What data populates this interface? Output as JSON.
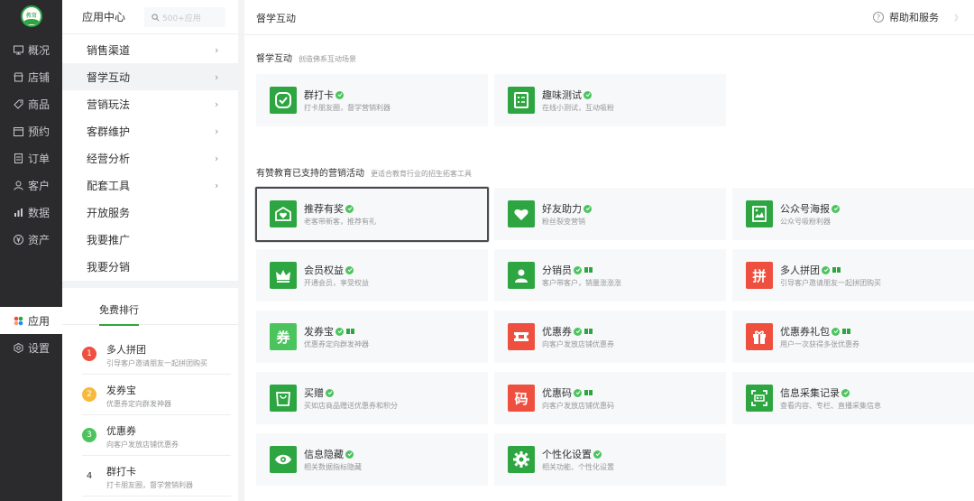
{
  "rail": {
    "items": [
      {
        "label": "概况",
        "icon": "monitor-icon"
      },
      {
        "label": "店铺",
        "icon": "store-icon"
      },
      {
        "label": "商品",
        "icon": "tag-icon"
      },
      {
        "label": "预约",
        "icon": "calendar-icon"
      },
      {
        "label": "订单",
        "icon": "order-icon"
      },
      {
        "label": "客户",
        "icon": "user-icon"
      },
      {
        "label": "数据",
        "icon": "bar-chart-icon"
      },
      {
        "label": "资产",
        "icon": "yen-icon"
      }
    ],
    "app": {
      "label": "应用",
      "icon": "apps-icon"
    },
    "settings": {
      "label": "设置",
      "icon": "gear-icon"
    }
  },
  "subnav": {
    "title": "应用中心",
    "search_placeholder": "500+应用",
    "items": [
      {
        "label": "销售渠道",
        "has_arrow": true
      },
      {
        "label": "督学互动",
        "has_arrow": true
      },
      {
        "label": "营销玩法",
        "has_arrow": true
      },
      {
        "label": "客群维护",
        "has_arrow": true
      },
      {
        "label": "经营分析",
        "has_arrow": true
      },
      {
        "label": "配套工具",
        "has_arrow": true
      },
      {
        "label": "开放服务",
        "has_arrow": false
      },
      {
        "label": "我要推广",
        "has_arrow": false
      },
      {
        "label": "我要分销",
        "has_arrow": false
      }
    ],
    "rank_tab": "免费排行",
    "rank": [
      {
        "num": "1",
        "name": "多人拼团",
        "desc": "引导客户邀请朋友一起拼团购买",
        "color": "#ee0a24"
      },
      {
        "num": "2",
        "name": "发券宝",
        "desc": "优惠券定向群发神器",
        "color": "#ff976a"
      },
      {
        "num": "3",
        "name": "优惠券",
        "desc": "向客户发放店铺优惠券",
        "color": "#2da641"
      },
      {
        "num": "4",
        "name": "群打卡",
        "desc": "打卡朋友圈，督学营销利器",
        "color": ""
      }
    ]
  },
  "main": {
    "page_title": "督学互动",
    "help_label": "帮助和服务",
    "collapse_label": "》",
    "section1": {
      "title": "督学互动",
      "subtitle": "创造佛系互动场景"
    },
    "section2": {
      "title": "有赞教育已支持的营销活动",
      "subtitle": "更适合教育行业的招生拓客工具"
    },
    "cards1": [
      {
        "name": "群打卡",
        "desc": "打卡朋友圈，督学营销利器",
        "color": "#2da641",
        "icon": "check-badge-icon"
      },
      {
        "name": "趣味测试",
        "desc": "在线小测试，互动吸粉",
        "color": "#2da641",
        "icon": "quiz-list-icon"
      }
    ],
    "cards2": [
      {
        "name": "推荐有奖",
        "desc": "老客带新客，推荐有礼",
        "color": "#2da641",
        "icon": "gift-heart-icon",
        "badge": false
      },
      {
        "name": "好友助力",
        "desc": "粉丝裂变营销",
        "color": "#2da641",
        "icon": "heart-icon",
        "badge": false
      },
      {
        "name": "公众号海报",
        "desc": "公众号吸粉利器",
        "color": "#2da641",
        "icon": "poster-icon",
        "badge": false
      },
      {
        "name": "会员权益",
        "desc": "开通会员，享受权益",
        "color": "#2da641",
        "icon": "crown-icon",
        "badge": false
      },
      {
        "name": "分销员",
        "desc": "客户带客户，销量涨涨涨",
        "color": "#2da641",
        "icon": "distributor-icon",
        "badge": true
      },
      {
        "name": "多人拼团",
        "desc": "引导客户邀请朋友一起拼团购买",
        "color": "#ee4f3f",
        "icon": "pin-icon",
        "badge": true,
        "glyph": "拼"
      },
      {
        "name": "发券宝",
        "desc": "优惠券定向群发神器",
        "color": "#4cc45e",
        "icon": "coupon-text-icon",
        "badge": true,
        "glyph": "券"
      },
      {
        "name": "优惠券",
        "desc": "向客户发放店铺优惠券",
        "color": "#ee4f3f",
        "icon": "ticket-icon",
        "badge": true
      },
      {
        "name": "优惠券礼包",
        "desc": "用户一次获得多张优惠券",
        "color": "#ee4f3f",
        "icon": "gift-box-icon",
        "badge": true
      },
      {
        "name": "买赠",
        "desc": "买如店商品赠送优惠券和积分",
        "color": "#2da641",
        "icon": "shopping-bag-icon",
        "badge": false
      },
      {
        "name": "优惠码",
        "desc": "向客户发放店铺优惠码",
        "color": "#ee4f3f",
        "icon": "code-text-icon",
        "badge": true,
        "glyph": "码"
      },
      {
        "name": "信息采集记录",
        "desc": "查看内容、专栏、直播采集信息",
        "color": "#2da641",
        "icon": "id-scan-icon",
        "badge": false
      },
      {
        "name": "信息隐藏",
        "desc": "相关数据指标隐藏",
        "color": "#2da641",
        "icon": "eye-icon",
        "badge": false
      },
      {
        "name": "个性化设置",
        "desc": "相关功能、个性化设置",
        "color": "#2da641",
        "icon": "gear-icon",
        "badge": false
      }
    ]
  }
}
